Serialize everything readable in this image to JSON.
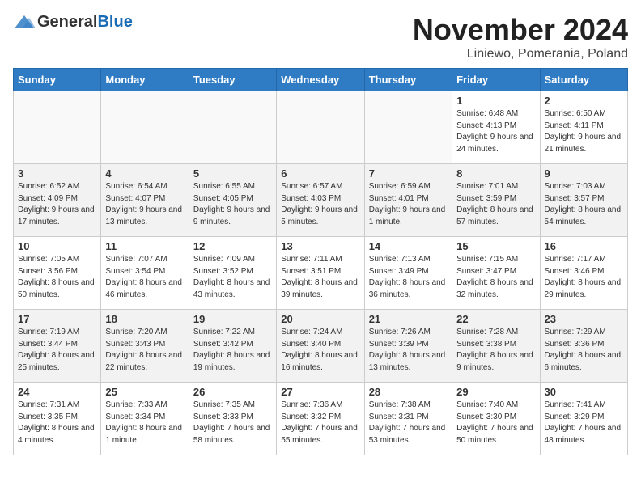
{
  "header": {
    "logo_general": "General",
    "logo_blue": "Blue",
    "month_title": "November 2024",
    "location": "Liniewo, Pomerania, Poland"
  },
  "days_of_week": [
    "Sunday",
    "Monday",
    "Tuesday",
    "Wednesday",
    "Thursday",
    "Friday",
    "Saturday"
  ],
  "weeks": [
    {
      "alt": false,
      "days": [
        {
          "num": "",
          "info": ""
        },
        {
          "num": "",
          "info": ""
        },
        {
          "num": "",
          "info": ""
        },
        {
          "num": "",
          "info": ""
        },
        {
          "num": "",
          "info": ""
        },
        {
          "num": "1",
          "info": "Sunrise: 6:48 AM\nSunset: 4:13 PM\nDaylight: 9 hours and 24 minutes."
        },
        {
          "num": "2",
          "info": "Sunrise: 6:50 AM\nSunset: 4:11 PM\nDaylight: 9 hours and 21 minutes."
        }
      ]
    },
    {
      "alt": true,
      "days": [
        {
          "num": "3",
          "info": "Sunrise: 6:52 AM\nSunset: 4:09 PM\nDaylight: 9 hours and 17 minutes."
        },
        {
          "num": "4",
          "info": "Sunrise: 6:54 AM\nSunset: 4:07 PM\nDaylight: 9 hours and 13 minutes."
        },
        {
          "num": "5",
          "info": "Sunrise: 6:55 AM\nSunset: 4:05 PM\nDaylight: 9 hours and 9 minutes."
        },
        {
          "num": "6",
          "info": "Sunrise: 6:57 AM\nSunset: 4:03 PM\nDaylight: 9 hours and 5 minutes."
        },
        {
          "num": "7",
          "info": "Sunrise: 6:59 AM\nSunset: 4:01 PM\nDaylight: 9 hours and 1 minute."
        },
        {
          "num": "8",
          "info": "Sunrise: 7:01 AM\nSunset: 3:59 PM\nDaylight: 8 hours and 57 minutes."
        },
        {
          "num": "9",
          "info": "Sunrise: 7:03 AM\nSunset: 3:57 PM\nDaylight: 8 hours and 54 minutes."
        }
      ]
    },
    {
      "alt": false,
      "days": [
        {
          "num": "10",
          "info": "Sunrise: 7:05 AM\nSunset: 3:56 PM\nDaylight: 8 hours and 50 minutes."
        },
        {
          "num": "11",
          "info": "Sunrise: 7:07 AM\nSunset: 3:54 PM\nDaylight: 8 hours and 46 minutes."
        },
        {
          "num": "12",
          "info": "Sunrise: 7:09 AM\nSunset: 3:52 PM\nDaylight: 8 hours and 43 minutes."
        },
        {
          "num": "13",
          "info": "Sunrise: 7:11 AM\nSunset: 3:51 PM\nDaylight: 8 hours and 39 minutes."
        },
        {
          "num": "14",
          "info": "Sunrise: 7:13 AM\nSunset: 3:49 PM\nDaylight: 8 hours and 36 minutes."
        },
        {
          "num": "15",
          "info": "Sunrise: 7:15 AM\nSunset: 3:47 PM\nDaylight: 8 hours and 32 minutes."
        },
        {
          "num": "16",
          "info": "Sunrise: 7:17 AM\nSunset: 3:46 PM\nDaylight: 8 hours and 29 minutes."
        }
      ]
    },
    {
      "alt": true,
      "days": [
        {
          "num": "17",
          "info": "Sunrise: 7:19 AM\nSunset: 3:44 PM\nDaylight: 8 hours and 25 minutes."
        },
        {
          "num": "18",
          "info": "Sunrise: 7:20 AM\nSunset: 3:43 PM\nDaylight: 8 hours and 22 minutes."
        },
        {
          "num": "19",
          "info": "Sunrise: 7:22 AM\nSunset: 3:42 PM\nDaylight: 8 hours and 19 minutes."
        },
        {
          "num": "20",
          "info": "Sunrise: 7:24 AM\nSunset: 3:40 PM\nDaylight: 8 hours and 16 minutes."
        },
        {
          "num": "21",
          "info": "Sunrise: 7:26 AM\nSunset: 3:39 PM\nDaylight: 8 hours and 13 minutes."
        },
        {
          "num": "22",
          "info": "Sunrise: 7:28 AM\nSunset: 3:38 PM\nDaylight: 8 hours and 9 minutes."
        },
        {
          "num": "23",
          "info": "Sunrise: 7:29 AM\nSunset: 3:36 PM\nDaylight: 8 hours and 6 minutes."
        }
      ]
    },
    {
      "alt": false,
      "days": [
        {
          "num": "24",
          "info": "Sunrise: 7:31 AM\nSunset: 3:35 PM\nDaylight: 8 hours and 4 minutes."
        },
        {
          "num": "25",
          "info": "Sunrise: 7:33 AM\nSunset: 3:34 PM\nDaylight: 8 hours and 1 minute."
        },
        {
          "num": "26",
          "info": "Sunrise: 7:35 AM\nSunset: 3:33 PM\nDaylight: 7 hours and 58 minutes."
        },
        {
          "num": "27",
          "info": "Sunrise: 7:36 AM\nSunset: 3:32 PM\nDaylight: 7 hours and 55 minutes."
        },
        {
          "num": "28",
          "info": "Sunrise: 7:38 AM\nSunset: 3:31 PM\nDaylight: 7 hours and 53 minutes."
        },
        {
          "num": "29",
          "info": "Sunrise: 7:40 AM\nSunset: 3:30 PM\nDaylight: 7 hours and 50 minutes."
        },
        {
          "num": "30",
          "info": "Sunrise: 7:41 AM\nSunset: 3:29 PM\nDaylight: 7 hours and 48 minutes."
        }
      ]
    }
  ]
}
